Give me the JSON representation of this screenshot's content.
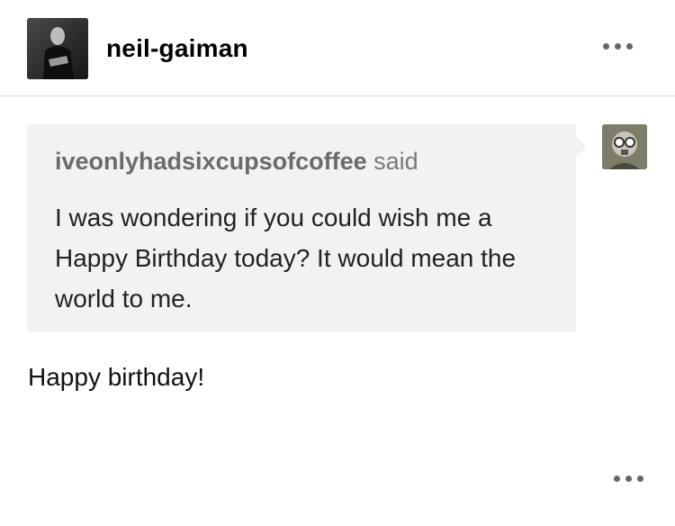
{
  "header": {
    "blog_name": "neil-gaiman",
    "avatar_icon": "user-avatar-photo",
    "menu_icon": "more-options-icon"
  },
  "ask": {
    "asker_name": "iveonlyhadsixcupsofcoffee",
    "said_label": "said",
    "question": "I was wondering if you could wish me a Happy Birthday today? It would mean the world to me.",
    "asker_avatar_icon": "asker-avatar-photo"
  },
  "answer": {
    "text": "Happy birthday!"
  },
  "footer": {
    "menu_icon": "more-options-icon"
  },
  "colors": {
    "bubble": "#f2f2f2",
    "divider": "#d9d9d9",
    "muted_text": "#7a7a7a",
    "dots": "#666666"
  }
}
